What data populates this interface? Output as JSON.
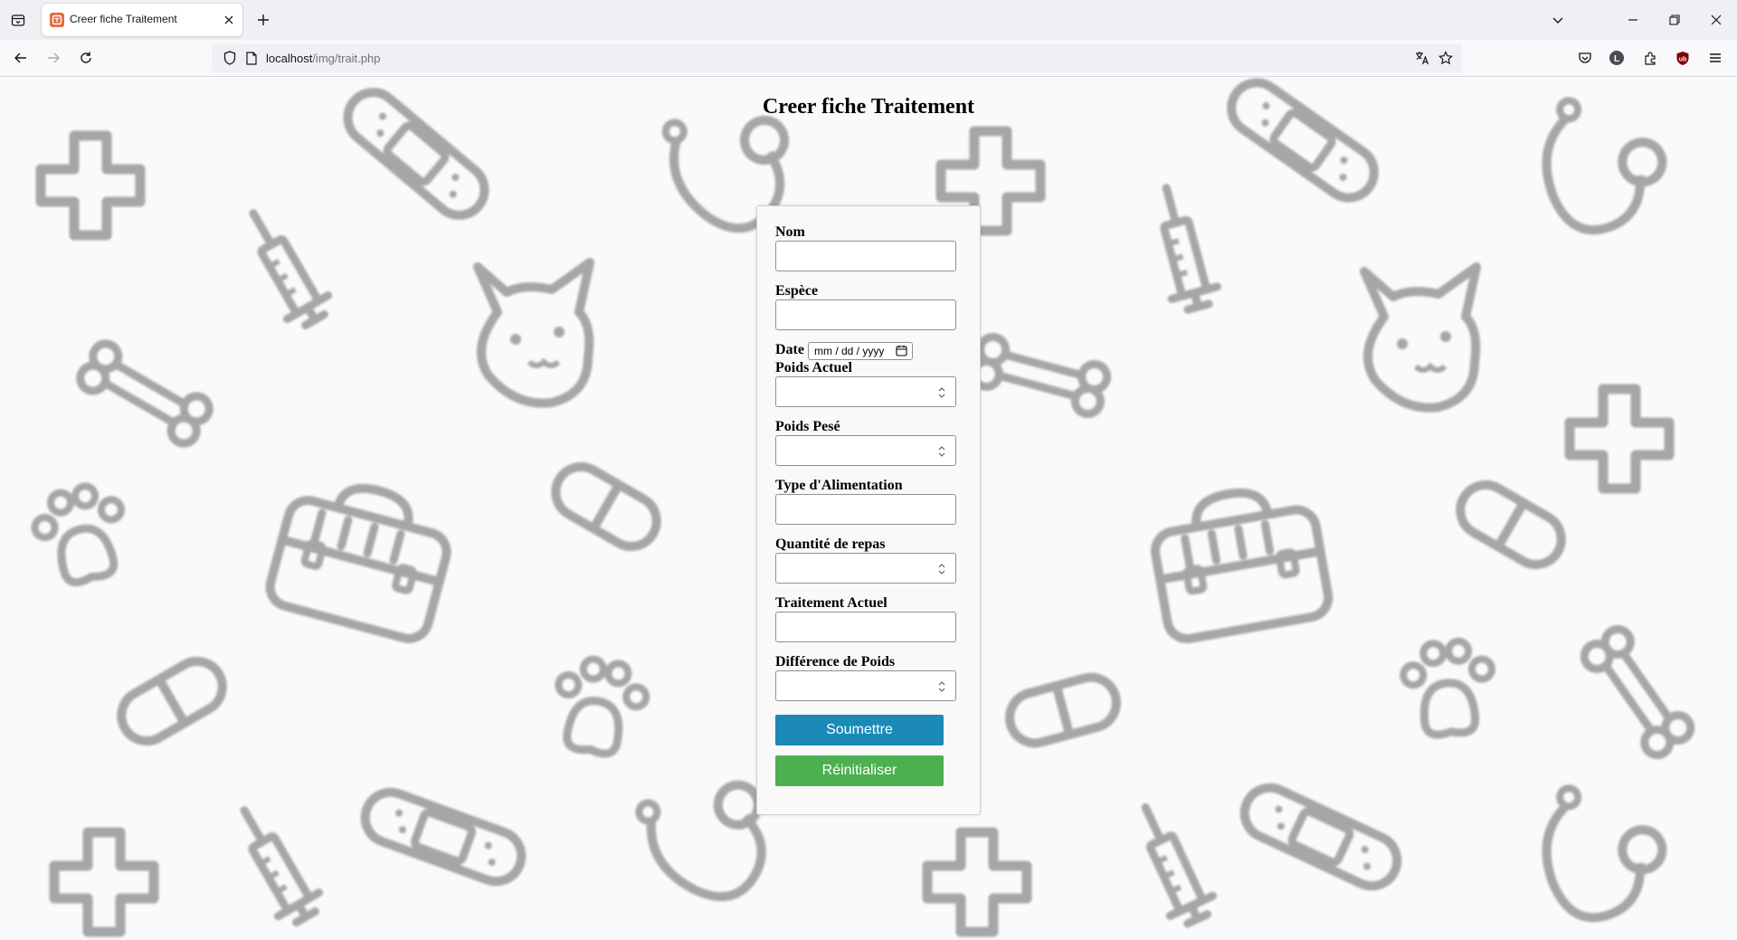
{
  "browser": {
    "tab_title": "Creer fiche Traitement",
    "url_host": "localhost",
    "url_path": "/img/trait.php"
  },
  "page": {
    "title": "Creer fiche Traitement",
    "fields": {
      "nom": {
        "label": "Nom",
        "value": ""
      },
      "espece": {
        "label": "Espèce",
        "value": ""
      },
      "date": {
        "label": "Date",
        "placeholder": "mm / dd / yyyy"
      },
      "poids_actuel": {
        "label": "Poids Actuel",
        "value": ""
      },
      "poids_pese": {
        "label": "Poids Pesé",
        "value": ""
      },
      "type_alimentation": {
        "label": "Type d'Alimentation",
        "value": ""
      },
      "quantite_repas": {
        "label": "Quantité de repas",
        "value": ""
      },
      "traitement_actuel": {
        "label": "Traitement Actuel",
        "value": ""
      },
      "difference_poids": {
        "label": "Différence de Poids",
        "value": ""
      }
    },
    "buttons": {
      "submit": "Soumettre",
      "reset": "Réinitialiser"
    }
  },
  "colors": {
    "submit_button": "#1b8ab8",
    "reset_button": "#4caf50",
    "pattern_stroke": "#8a8a8a"
  },
  "icons": [
    "tab-list-icon",
    "favicon-icon",
    "close-icon",
    "plus-icon",
    "chevron-down-icon",
    "minimize-icon",
    "restore-icon",
    "back-arrow-icon",
    "forward-arrow-icon",
    "reload-icon",
    "shield-icon",
    "page-icon",
    "translate-icon",
    "star-icon",
    "pocket-icon",
    "account-icon",
    "extensions-icon",
    "ublock-icon",
    "menu-icon",
    "calendar-icon"
  ]
}
